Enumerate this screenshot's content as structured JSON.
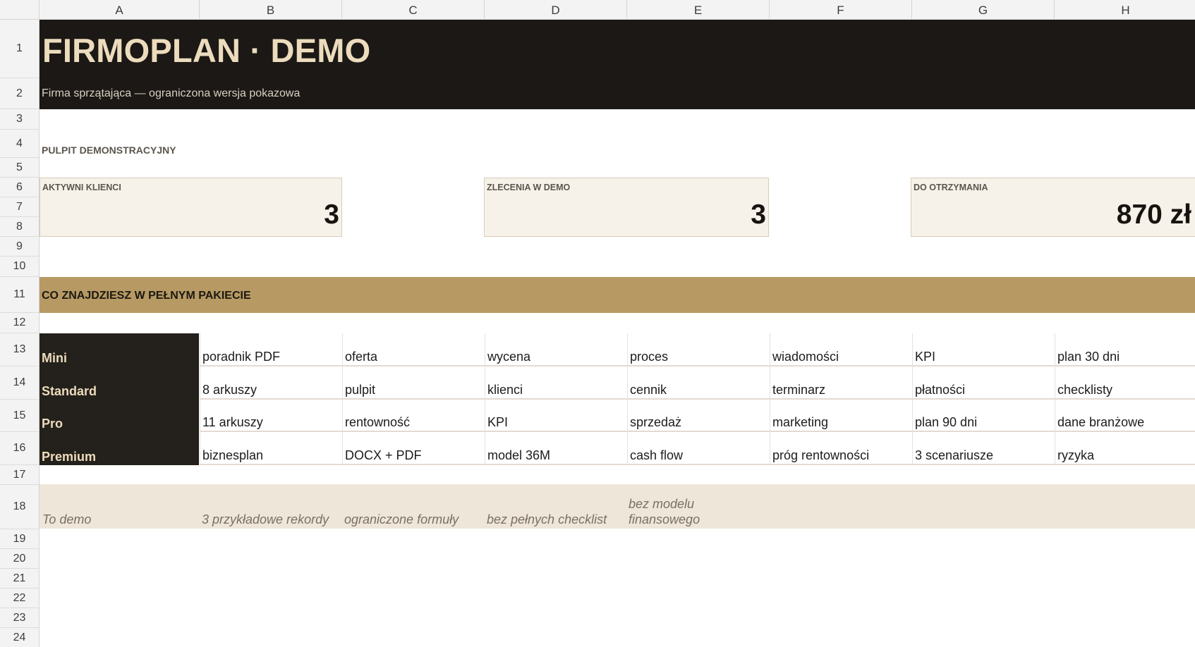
{
  "columns": [
    "A",
    "B",
    "C",
    "D",
    "E",
    "F",
    "G",
    "H"
  ],
  "rows": [
    "1",
    "2",
    "3",
    "4",
    "5",
    "6",
    "7",
    "8",
    "9",
    "10",
    "11",
    "12",
    "13",
    "14",
    "15",
    "16",
    "17",
    "18",
    "19",
    "20",
    "21",
    "22",
    "23",
    "24"
  ],
  "header": {
    "title": "FIRMOPLAN · DEMO",
    "subtitle": "Firma sprzątająca — ograniczona wersja pokazowa"
  },
  "dashboard": {
    "label": "PULPIT DEMONSTRACYJNY",
    "kpis": [
      {
        "label": "AKTYWNI KLIENCI",
        "value": "3"
      },
      {
        "label": "ZLECENIA W DEMO",
        "value": "3"
      },
      {
        "label": "DO OTRZYMANIA",
        "value": "870 zł"
      }
    ]
  },
  "packages": {
    "heading": "CO ZNAJDZIESZ W PEŁNYM PAKIECIE",
    "tiers": [
      {
        "name": "Mini",
        "items": [
          "poradnik PDF",
          "oferta",
          "wycena",
          "proces",
          "wiadomości",
          "KPI",
          "plan 30 dni"
        ]
      },
      {
        "name": "Standard",
        "items": [
          "8 arkuszy",
          "pulpit",
          "klienci",
          "cennik",
          "terminarz",
          "płatności",
          "checklisty"
        ]
      },
      {
        "name": "Pro",
        "items": [
          "11 arkuszy",
          "rentowność",
          "KPI",
          "sprzedaż",
          "marketing",
          "plan 90 dni",
          "dane branżowe"
        ]
      },
      {
        "name": "Premium",
        "items": [
          "biznesplan",
          "DOCX + PDF",
          "model 36M",
          "cash flow",
          "próg rentowności",
          "3 scenariusze",
          "ryzyka"
        ]
      }
    ]
  },
  "demo_note": {
    "items": [
      "To demo",
      "3 przykładowe rekordy",
      "ograniczone formuły",
      "bez pełnych checklist",
      "bez modelu finansowego"
    ]
  }
}
